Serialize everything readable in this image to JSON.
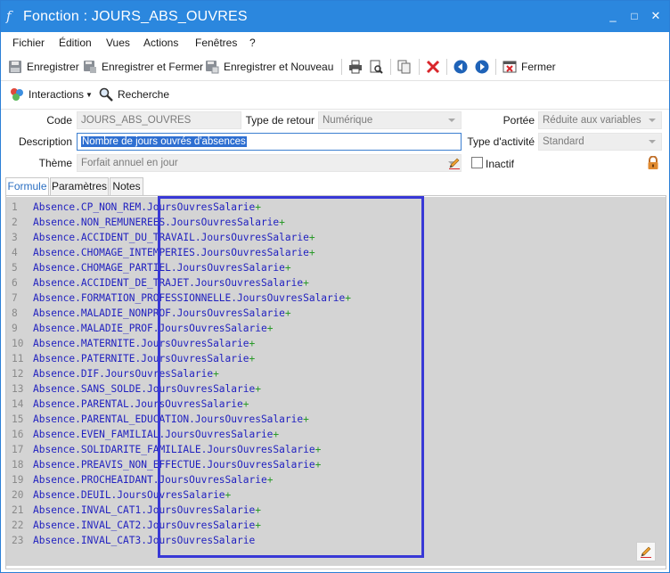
{
  "window": {
    "title": "Fonction : JOURS_ABS_OUVRES",
    "minimize_glyph": "_",
    "maximize_glyph": "□",
    "close_glyph": "✕"
  },
  "menu": {
    "items": [
      "Fichier",
      "Édition",
      "Vues",
      "Actions",
      "Fenêtres",
      "?"
    ]
  },
  "toolbar": {
    "save_label": "Enregistrer",
    "save_close_label": "Enregistrer et Fermer",
    "save_new_label": "Enregistrer et Nouveau",
    "close_label": "Fermer"
  },
  "toolbar2": {
    "interactions_label": "Interactions",
    "search_label": "Recherche"
  },
  "form": {
    "code_label": "Code",
    "code_value": "JOURS_ABS_OUVRES",
    "return_type_label": "Type de retour",
    "return_type_value": "Numérique",
    "scope_label": "Portée",
    "scope_value": "Réduite aux variables",
    "description_label": "Description",
    "description_value": "Nombre de jours ouvrés d'absences",
    "activity_type_label": "Type d'activité",
    "activity_type_value": "Standard",
    "theme_label": "Thème",
    "theme_value": "Forfait annuel en jour",
    "inactive_label": "Inactif",
    "inactive_checked": false
  },
  "tabs": [
    {
      "label": "Formule",
      "active": true
    },
    {
      "label": "Paramètres",
      "active": false
    },
    {
      "label": "Notes",
      "active": false
    }
  ],
  "editor": {
    "lines": [
      {
        "n": "1",
        "text": "Absence.CP_NON_REM.JoursOuvresSalarie",
        "op": "+"
      },
      {
        "n": "2",
        "text": "Absence.NON_REMUNEREES.JoursOuvresSalarie",
        "op": "+"
      },
      {
        "n": "3",
        "text": "Absence.ACCIDENT_DU_TRAVAIL.JoursOuvresSalarie",
        "op": "+"
      },
      {
        "n": "4",
        "text": "Absence.CHOMAGE_INTEMPERIES.JoursOuvresSalarie",
        "op": "+"
      },
      {
        "n": "5",
        "text": "Absence.CHOMAGE_PARTIEL.JoursOuvresSalarie",
        "op": "+"
      },
      {
        "n": "6",
        "text": "Absence.ACCIDENT_DE_TRAJET.JoursOuvresSalarie",
        "op": "+"
      },
      {
        "n": "7",
        "text": "Absence.FORMATION_PROFESSIONNELLE.JoursOuvresSalarie",
        "op": "+"
      },
      {
        "n": "8",
        "text": "Absence.MALADIE_NONPROF.JoursOuvresSalarie",
        "op": "+"
      },
      {
        "n": "9",
        "text": "Absence.MALADIE_PROF.JoursOuvresSalarie",
        "op": "+"
      },
      {
        "n": "10",
        "text": "Absence.MATERNITE.JoursOuvresSalarie",
        "op": "+"
      },
      {
        "n": "11",
        "text": "Absence.PATERNITE.JoursOuvresSalarie",
        "op": "+"
      },
      {
        "n": "12",
        "text": "Absence.DIF.JoursOuvresSalarie",
        "op": "+"
      },
      {
        "n": "13",
        "text": "Absence.SANS_SOLDE.JoursOuvresSalarie",
        "op": "+"
      },
      {
        "n": "14",
        "text": "Absence.PARENTAL.JoursOuvresSalarie",
        "op": "+"
      },
      {
        "n": "15",
        "text": "Absence.PARENTAL_EDUCATION.JoursOuvresSalarie",
        "op": "+"
      },
      {
        "n": "16",
        "text": "Absence.EVEN_FAMILIAL.JoursOuvresSalarie",
        "op": "+"
      },
      {
        "n": "17",
        "text": "Absence.SOLIDARITE_FAMILIALE.JoursOuvresSalarie",
        "op": "+"
      },
      {
        "n": "18",
        "text": "Absence.PREAVIS_NON_EFFECTUE.JoursOuvresSalarie",
        "op": "+"
      },
      {
        "n": "19",
        "text": "Absence.PROCHEAIDANT.JoursOuvresSalarie",
        "op": "+"
      },
      {
        "n": "20",
        "text": "Absence.DEUIL.JoursOuvresSalarie",
        "op": "+"
      },
      {
        "n": "21",
        "text": "Absence.INVAL_CAT1.JoursOuvresSalarie",
        "op": "+"
      },
      {
        "n": "22",
        "text": "Absence.INVAL_CAT2.JoursOuvresSalarie",
        "op": "+"
      },
      {
        "n": "23",
        "text": "Absence.INVAL_CAT3.JoursOuvresSalarie",
        "op": ""
      }
    ]
  },
  "colors": {
    "titlebar": "#2b87de",
    "code_text": "#1f1fbf",
    "operator": "#2a9a2a",
    "highlight_box": "#3838d6",
    "delete_red": "#d9262b"
  }
}
